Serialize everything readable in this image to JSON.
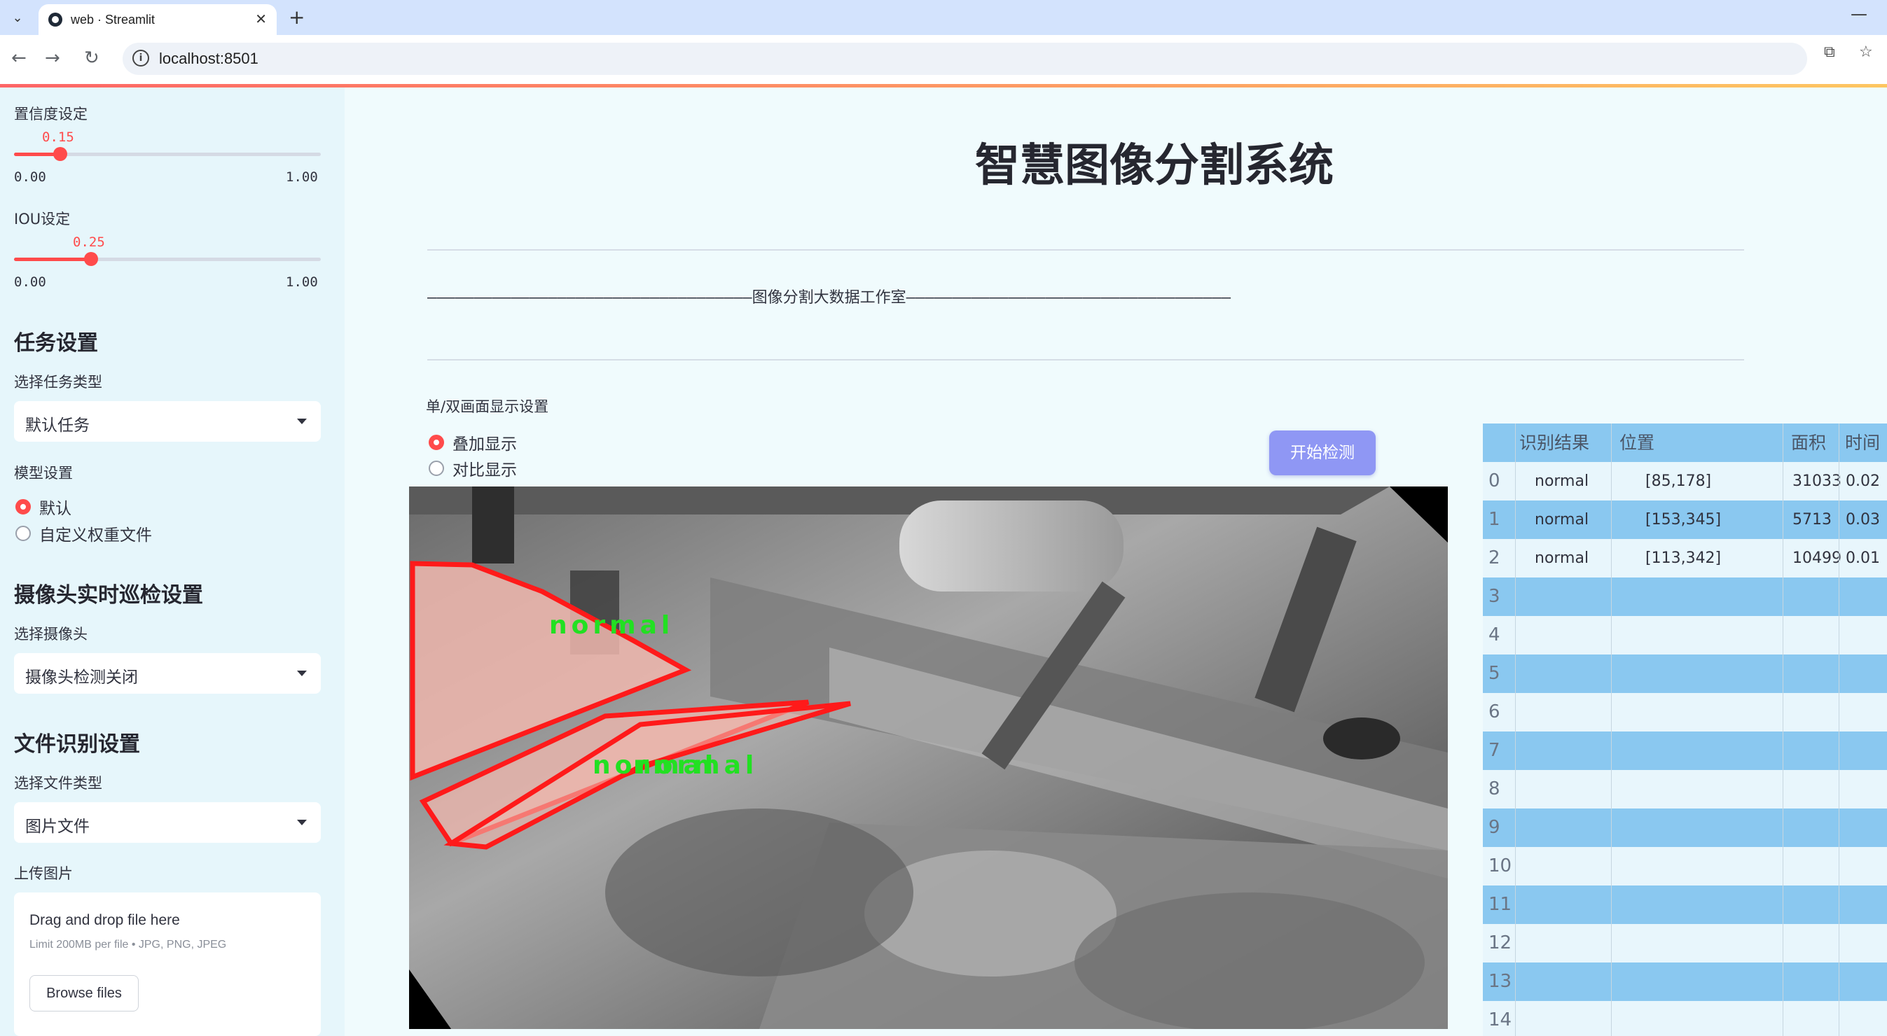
{
  "browser": {
    "tab_title": "web · Streamlit",
    "url": "localhost:8501"
  },
  "sidebar": {
    "confidence": {
      "label": "置信度设定",
      "value": "0.15",
      "min": "0.00",
      "max": "1.00",
      "fraction": 0.15
    },
    "iou": {
      "label": "IOU设定",
      "value": "0.25",
      "min": "0.00",
      "max": "1.00",
      "fraction": 0.25
    },
    "task_header": "任务设置",
    "task_type_label": "选择任务类型",
    "task_type_value": "默认任务",
    "model_label": "模型设置",
    "model_options": [
      "默认",
      "自定义权重文件"
    ],
    "camera_header": "摄像头实时巡检设置",
    "camera_label": "选择摄像头",
    "camera_value": "摄像头检测关闭",
    "file_header": "文件识别设置",
    "file_type_label": "选择文件类型",
    "file_type_value": "图片文件",
    "upload_label": "上传图片",
    "upload_title": "Drag and drop file here",
    "upload_limit": "Limit 200MB per file • JPG, PNG, JPEG",
    "browse_button": "Browse files"
  },
  "main": {
    "title": "智慧图像分割系统",
    "studio_banner": "———————————————————————————————————图像分割大数据工作室———————————————————————————————————",
    "display_setting_label": "单/双画面显示设置",
    "display_options": [
      "叠加显示",
      "对比显示"
    ],
    "start_button": "开始检测",
    "detections": [
      "normal",
      "normal",
      "normal"
    ]
  },
  "table": {
    "columns": [
      "",
      "识别结果",
      "位置",
      "面积",
      "时间"
    ],
    "rows": [
      {
        "idx": "0",
        "result": "normal",
        "pos": "[85,178]",
        "area": "31033",
        "time": "0.02"
      },
      {
        "idx": "1",
        "result": "normal",
        "pos": "[153,345]",
        "area": "5713",
        "time": "0.03"
      },
      {
        "idx": "2",
        "result": "normal",
        "pos": "[113,342]",
        "area": "10499",
        "time": "0.01"
      },
      {
        "idx": "3",
        "result": "",
        "pos": "",
        "area": "",
        "time": ""
      },
      {
        "idx": "4",
        "result": "",
        "pos": "",
        "area": "",
        "time": ""
      },
      {
        "idx": "5",
        "result": "",
        "pos": "",
        "area": "",
        "time": ""
      },
      {
        "idx": "6",
        "result": "",
        "pos": "",
        "area": "",
        "time": ""
      },
      {
        "idx": "7",
        "result": "",
        "pos": "",
        "area": "",
        "time": ""
      },
      {
        "idx": "8",
        "result": "",
        "pos": "",
        "area": "",
        "time": ""
      },
      {
        "idx": "9",
        "result": "",
        "pos": "",
        "area": "",
        "time": ""
      },
      {
        "idx": "10",
        "result": "",
        "pos": "",
        "area": "",
        "time": ""
      },
      {
        "idx": "11",
        "result": "",
        "pos": "",
        "area": "",
        "time": ""
      },
      {
        "idx": "12",
        "result": "",
        "pos": "",
        "area": "",
        "time": ""
      },
      {
        "idx": "13",
        "result": "",
        "pos": "",
        "area": "",
        "time": ""
      },
      {
        "idx": "14",
        "result": "",
        "pos": "",
        "area": "",
        "time": ""
      }
    ]
  },
  "colors": {
    "accent": "#ff4b4b",
    "button": "#8f97f4",
    "table_stripe": "#8ac8f0",
    "mask": "#ff1a1a",
    "label": "#22e022"
  }
}
